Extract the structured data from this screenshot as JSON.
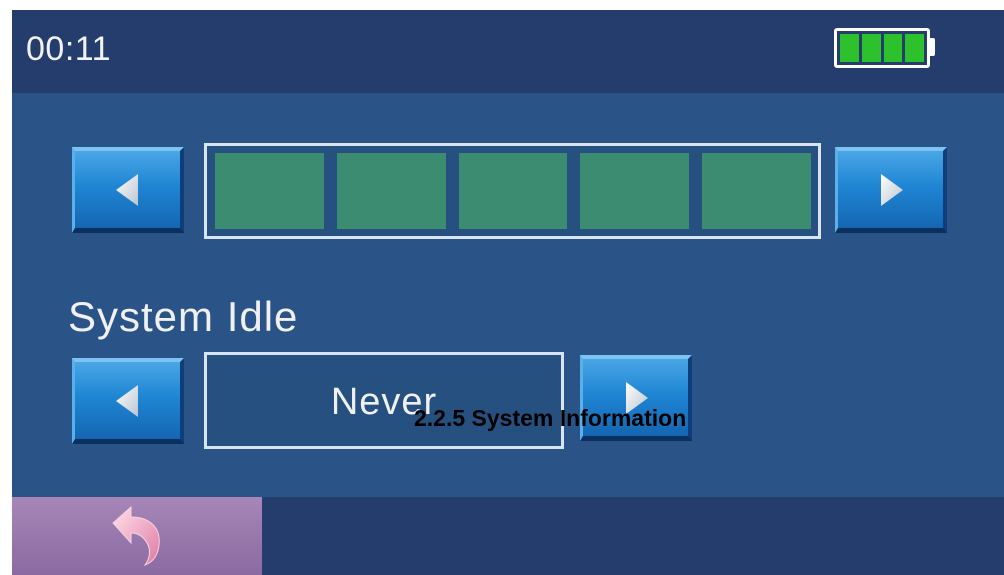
{
  "status_bar": {
    "time": "00:11",
    "battery_icon": "battery-full-icon",
    "battery_level_fraction": 1.0
  },
  "slider": {
    "segments_filled": 5,
    "segments_total": 5,
    "fill_color": "#3c8c72",
    "left_icon": "arrow-left-icon",
    "right_icon": "arrow-right-icon"
  },
  "system_idle": {
    "label": "System Idle",
    "value": "Never",
    "left_icon": "arrow-left-icon",
    "right_icon": "arrow-right-icon"
  },
  "bottom_bar": {
    "back_icon": "back-arrow-icon"
  },
  "caption": "2.2.5 System Information",
  "colors": {
    "background": "#2a5487",
    "bars": "#243d6c",
    "battery": "#2dc12d",
    "button": "#1f86d4",
    "back_button": "#9a7aad"
  }
}
